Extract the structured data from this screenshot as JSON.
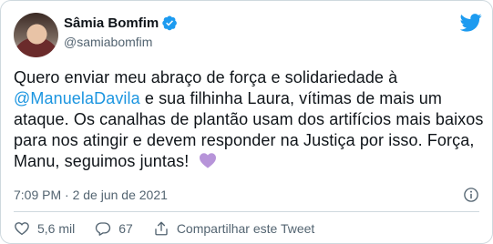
{
  "author": {
    "name": "Sâmia Bomfim",
    "handle": "@samiabomfim"
  },
  "tweet": {
    "text_part1": "Quero enviar meu abraço de força e solidariedade à ",
    "mention": "@ManuelaDavila",
    "text_part2": " e sua filhinha Laura, vítimas de mais um ataque. Os canalhas de plantão usam dos artifícios mais baixos para nos atingir e devem responder na Justiça por isso. Força, Manu, seguimos juntas!",
    "emoji": "purple-heart",
    "timestamp": "7:09 PM · 2 de jun de 2021"
  },
  "actions": {
    "likes": "5,6 mil",
    "replies": "67",
    "share_label": "Compartilhar este Tweet"
  },
  "colors": {
    "link": "#1b95e0",
    "twitter_blue": "#1d9bf0",
    "heart": "#b794d9",
    "secondary_text": "#536471"
  },
  "icons": [
    "verified-badge-icon",
    "twitter-bird-icon",
    "purple-heart-icon",
    "info-icon",
    "heart-icon",
    "reply-icon",
    "share-icon"
  ]
}
